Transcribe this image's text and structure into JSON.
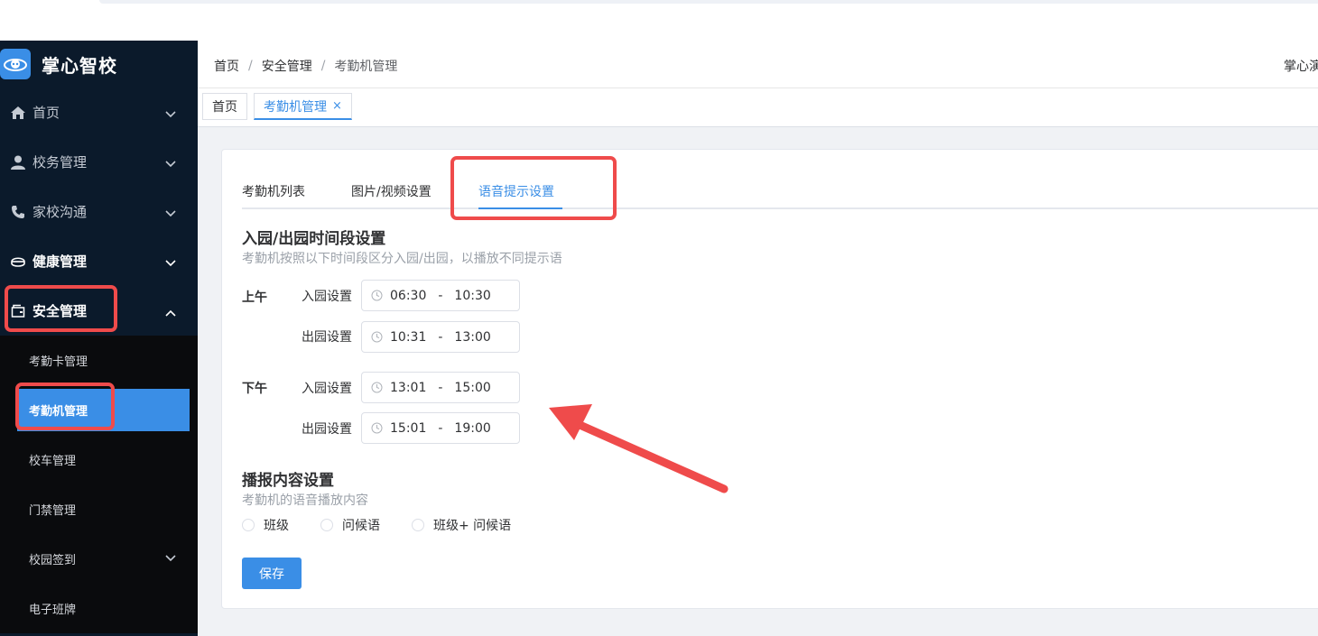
{
  "app": {
    "name": "掌心智校"
  },
  "sidebar": {
    "items": [
      {
        "label": "首页",
        "icon": "home-icon"
      },
      {
        "label": "校务管理",
        "icon": "user-icon"
      },
      {
        "label": "家校沟通",
        "icon": "phone-icon"
      },
      {
        "label": "健康管理",
        "icon": "health-icon"
      },
      {
        "label": "安全管理",
        "icon": "wallet-icon"
      }
    ],
    "subitems": [
      {
        "label": "考勤卡管理"
      },
      {
        "label": "考勤机管理"
      },
      {
        "label": "校车管理"
      },
      {
        "label": "门禁管理"
      },
      {
        "label": "校园签到"
      },
      {
        "label": "电子班牌"
      }
    ]
  },
  "header": {
    "breadcrumb": [
      "首页",
      "安全管理",
      "考勤机管理"
    ],
    "breadcrumb_sep": "/",
    "user": "掌心演示"
  },
  "tagsbar": {
    "tags": [
      {
        "label": "首页"
      },
      {
        "label": "考勤机管理",
        "close": "×"
      }
    ]
  },
  "tabs": [
    "考勤机列表",
    "图片/视频设置",
    "语音提示设置"
  ],
  "active_tab": "语音提示设置",
  "time_section": {
    "title": "入园/出园时间段设置",
    "desc": "考勤机按照以下时间段区分入园/出园，以播放不同提示语",
    "morning": {
      "label": "上午",
      "in_label": "入园设置",
      "in_start": "06:30",
      "in_end": "10:30",
      "out_label": "出园设置",
      "out_start": "10:31",
      "out_end": "13:00"
    },
    "afternoon": {
      "label": "下午",
      "in_label": "入园设置",
      "in_start": "13:01",
      "in_end": "15:00",
      "out_label": "出园设置",
      "out_start": "15:01",
      "out_end": "19:00"
    },
    "range_sep": "-"
  },
  "broadcast_section": {
    "title": "播报内容设置",
    "desc": "考勤机的语音播放内容",
    "options": [
      "班级",
      "问候语",
      "班级+ 问候语"
    ]
  },
  "save_label": "保存",
  "colors": {
    "accent": "#3a8ee6",
    "sidebar": "#0b1a2b",
    "highlight": "#ef4b4b"
  }
}
